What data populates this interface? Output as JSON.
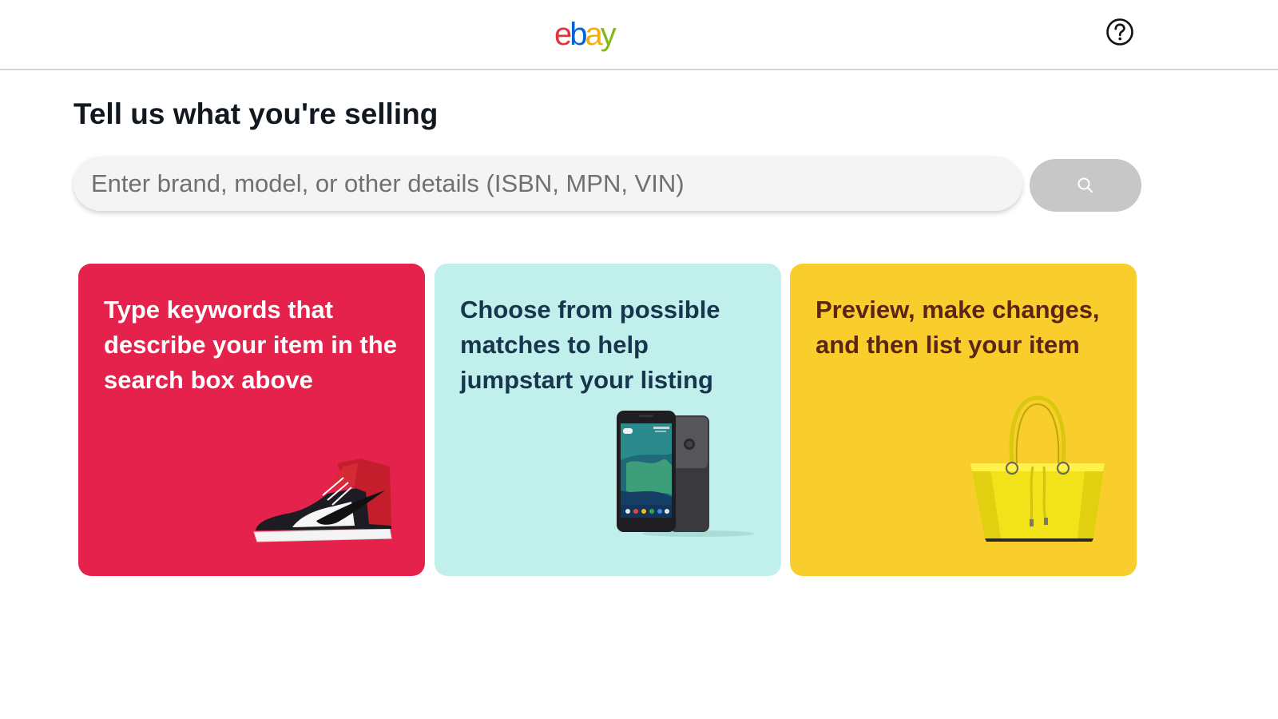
{
  "header": {
    "logo": {
      "letters": [
        "e",
        "b",
        "a",
        "y"
      ],
      "colors": [
        "#e53238",
        "#0064d2",
        "#f5af02",
        "#86b817"
      ]
    },
    "help_icon": "question-circle-icon"
  },
  "main": {
    "title": "Tell us what you're selling",
    "search": {
      "placeholder": "Enter brand, model, or other details (ISBN, MPN, VIN)",
      "value": "",
      "button_icon": "search-icon"
    },
    "cards": [
      {
        "text": "Type keywords that describe your item in the search box above",
        "color": "#e5224c",
        "image": "sneaker-image"
      },
      {
        "text": "Choose from possible matches to help jumpstart your listing",
        "color": "#c0efec",
        "image": "smartphone-image"
      },
      {
        "text": "Preview, make changes, and then list your item",
        "color": "#f9ce2c",
        "image": "handbag-image"
      }
    ]
  }
}
